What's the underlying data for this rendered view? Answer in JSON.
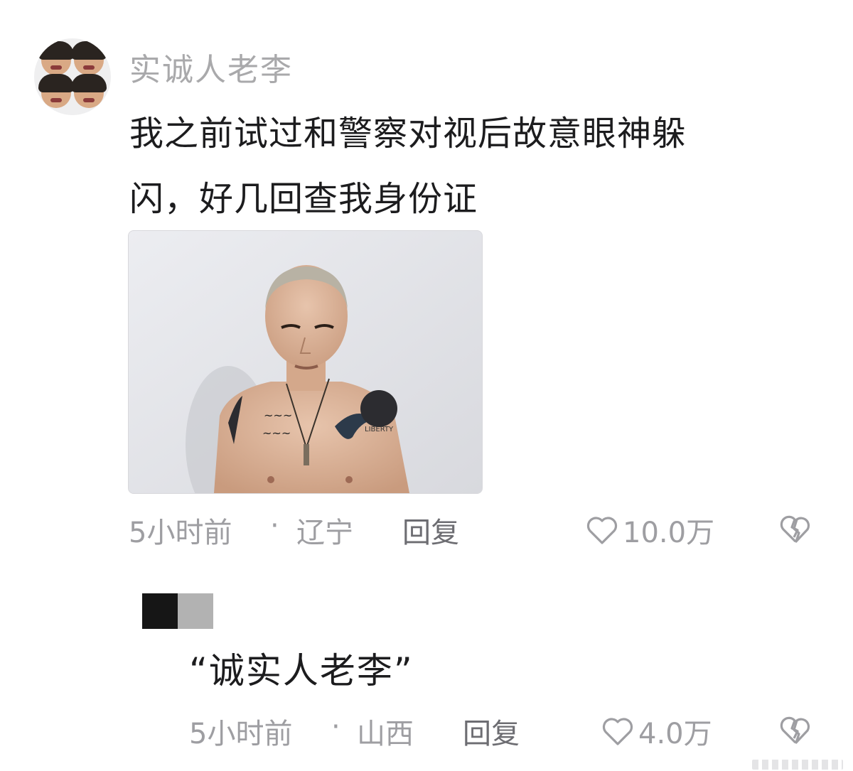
{
  "comment1": {
    "username": "实诚人老李",
    "text_line1": "我之前试过和警察对视后故意眼神躲",
    "text_line2": "闪，好几回查我身份证",
    "time": "5小时前",
    "separator": "·",
    "location": "辽宁",
    "reply_label": "回复",
    "likes": "10.0万",
    "photo_tattoo_text": "LIBERTY"
  },
  "comment2": {
    "text": "“诚实人老李”",
    "time": "5小时前",
    "separator": "·",
    "location": "山西",
    "reply_label": "回复",
    "likes": "4.0万"
  },
  "icons": {
    "like": "heart-outline-icon",
    "dislike": "broken-heart-icon"
  },
  "colors": {
    "text_primary": "#1c1c1e",
    "text_secondary": "#a9a9ab",
    "reply": "#6d6d72",
    "background": "#ffffff"
  }
}
